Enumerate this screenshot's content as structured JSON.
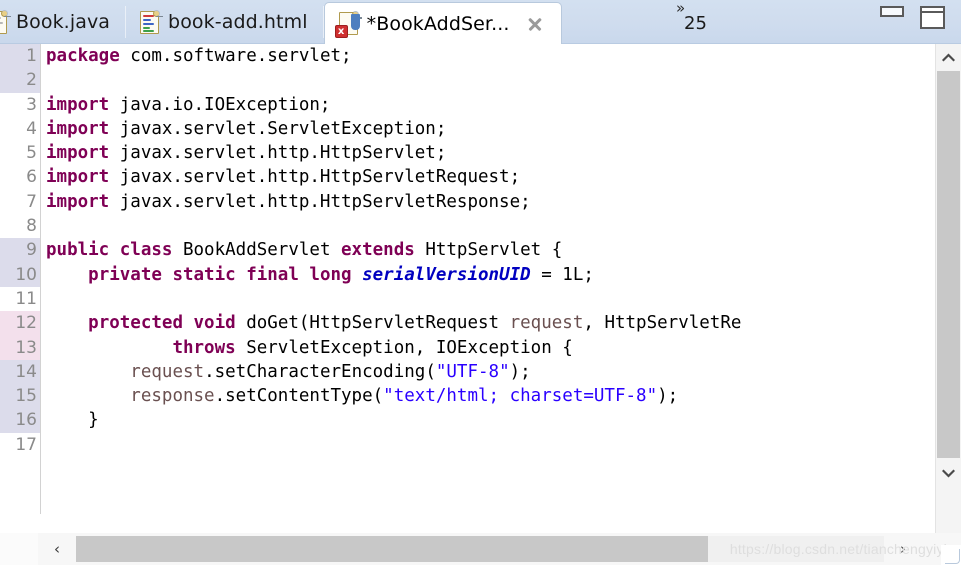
{
  "tabs": [
    {
      "label": "Book.java",
      "icon": "java-file-icon",
      "active": false,
      "modified": false,
      "has_error": false,
      "closable": false
    },
    {
      "label": "book-add.html",
      "icon": "html-file-icon",
      "active": false,
      "modified": false,
      "has_error": false,
      "closable": false
    },
    {
      "label": "*BookAddSer...",
      "icon": "java-file-error-icon",
      "active": true,
      "modified": true,
      "has_error": true,
      "closable": true,
      "close_label": "x"
    }
  ],
  "tab_overflow": {
    "chevron": "»",
    "count": "25"
  },
  "window_controls": {
    "minimize_label": "Minimize",
    "maximize_label": "Maximize"
  },
  "editor": {
    "lines": [
      {
        "num": "1",
        "gutter_highlight": "lavender",
        "fold": false,
        "tokens": [
          {
            "t": "package",
            "c": "kw"
          },
          {
            "t": " com.software.servlet;",
            "c": "plain"
          }
        ]
      },
      {
        "num": "2",
        "gutter_highlight": "lavender",
        "fold": false,
        "tokens": []
      },
      {
        "num": "3",
        "gutter_highlight": "none",
        "fold": true,
        "tokens": [
          {
            "t": "import",
            "c": "kw"
          },
          {
            "t": " java.io.IOException;",
            "c": "plain"
          }
        ]
      },
      {
        "num": "4",
        "gutter_highlight": "none",
        "fold": false,
        "tokens": [
          {
            "t": "import",
            "c": "kw"
          },
          {
            "t": " javax.servlet.ServletException;",
            "c": "plain"
          }
        ]
      },
      {
        "num": "5",
        "gutter_highlight": "none",
        "fold": false,
        "tokens": [
          {
            "t": "import",
            "c": "kw"
          },
          {
            "t": " javax.servlet.http.HttpServlet;",
            "c": "plain"
          }
        ]
      },
      {
        "num": "6",
        "gutter_highlight": "none",
        "fold": false,
        "tokens": [
          {
            "t": "import",
            "c": "kw"
          },
          {
            "t": " javax.servlet.http.HttpServletRequest;",
            "c": "plain"
          }
        ]
      },
      {
        "num": "7",
        "gutter_highlight": "none",
        "fold": false,
        "tokens": [
          {
            "t": "import",
            "c": "kw"
          },
          {
            "t": " javax.servlet.http.HttpServletResponse;",
            "c": "plain"
          }
        ]
      },
      {
        "num": "8",
        "gutter_highlight": "none",
        "fold": false,
        "tokens": []
      },
      {
        "num": "9",
        "gutter_highlight": "lavender",
        "fold": false,
        "tokens": [
          {
            "t": "public class",
            "c": "kw"
          },
          {
            "t": " BookAddServlet ",
            "c": "plain"
          },
          {
            "t": "extends",
            "c": "kw"
          },
          {
            "t": " HttpServlet {",
            "c": "plain"
          }
        ]
      },
      {
        "num": "10",
        "gutter_highlight": "lavender",
        "fold": false,
        "tokens": [
          {
            "t": "    ",
            "c": "plain"
          },
          {
            "t": "private static final long",
            "c": "kw"
          },
          {
            "t": " ",
            "c": "plain"
          },
          {
            "t": "serialVersionUID",
            "c": "fld"
          },
          {
            "t": " = 1L;",
            "c": "plain"
          }
        ]
      },
      {
        "num": "11",
        "gutter_highlight": "none",
        "fold": false,
        "tokens": []
      },
      {
        "num": "12",
        "gutter_highlight": "pink",
        "fold": true,
        "tokens": [
          {
            "t": "    ",
            "c": "plain"
          },
          {
            "t": "protected void",
            "c": "kw"
          },
          {
            "t": " doGet(HttpServletRequest ",
            "c": "plain"
          },
          {
            "t": "request",
            "c": "parm"
          },
          {
            "t": ", HttpServletRe",
            "c": "plain"
          }
        ]
      },
      {
        "num": "13",
        "gutter_highlight": "pink",
        "fold": false,
        "tokens": [
          {
            "t": "            ",
            "c": "plain"
          },
          {
            "t": "throws",
            "c": "kw"
          },
          {
            "t": " ServletException, IOException {",
            "c": "plain"
          }
        ]
      },
      {
        "num": "14",
        "gutter_highlight": "lavender",
        "fold": false,
        "tokens": [
          {
            "t": "        ",
            "c": "plain"
          },
          {
            "t": "request",
            "c": "parm"
          },
          {
            "t": ".setCharacterEncoding(",
            "c": "plain"
          },
          {
            "t": "\"UTF-8\"",
            "c": "str"
          },
          {
            "t": ");",
            "c": "plain"
          }
        ]
      },
      {
        "num": "15",
        "gutter_highlight": "lavender",
        "fold": false,
        "tokens": [
          {
            "t": "        ",
            "c": "plain"
          },
          {
            "t": "response",
            "c": "parm"
          },
          {
            "t": ".setContentType(",
            "c": "plain"
          },
          {
            "t": "\"text/html; charset=UTF-8\"",
            "c": "str"
          },
          {
            "t": ");",
            "c": "plain"
          }
        ]
      },
      {
        "num": "16",
        "gutter_highlight": "lavender",
        "fold": false,
        "tokens": [
          {
            "t": "    }",
            "c": "plain"
          }
        ]
      },
      {
        "num": "17",
        "gutter_highlight": "none",
        "fold": false,
        "tokens": []
      }
    ]
  },
  "scrollbars": {
    "vertical": {
      "up_arrow": "▲",
      "down_arrow": "▼"
    },
    "horizontal": {
      "left_arrow": "‹",
      "right_arrow": "›"
    }
  },
  "watermark": "https://blog.csdn.net/tianchengyiyi"
}
